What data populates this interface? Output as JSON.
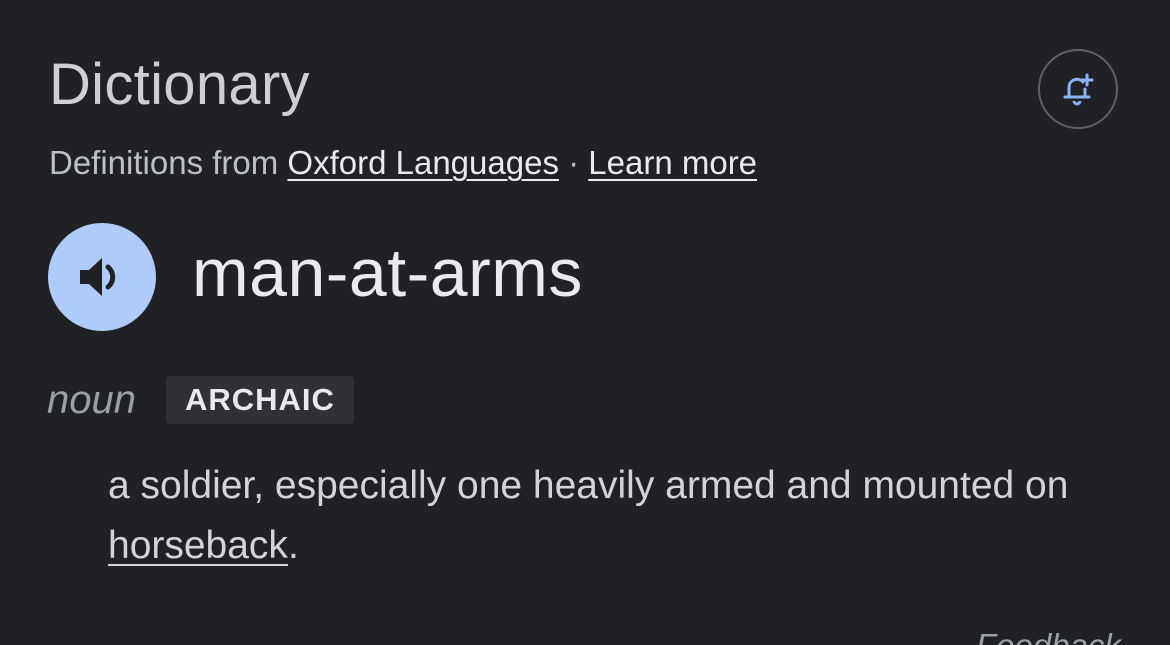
{
  "header": {
    "title": "Dictionary",
    "alert_icon": "bell-plus-icon"
  },
  "source": {
    "prefix": "Definitions from ",
    "source_link": "Oxford Languages",
    "separator": " · ",
    "learn_more": "Learn more"
  },
  "entry": {
    "speaker_icon": "speaker-icon",
    "word": "man-at-arms",
    "part_of_speech": "noun",
    "register_label": "ARCHAIC",
    "definition_text": "a soldier, especially one heavily armed and mounted on ",
    "definition_link": "horseback",
    "definition_end": "."
  },
  "footer": {
    "feedback": "Feedback"
  },
  "colors": {
    "background": "#202124",
    "speaker_button": "#aecbfa",
    "speaker_glyph": "#202124",
    "alert_icon": "#8ab4f8"
  }
}
